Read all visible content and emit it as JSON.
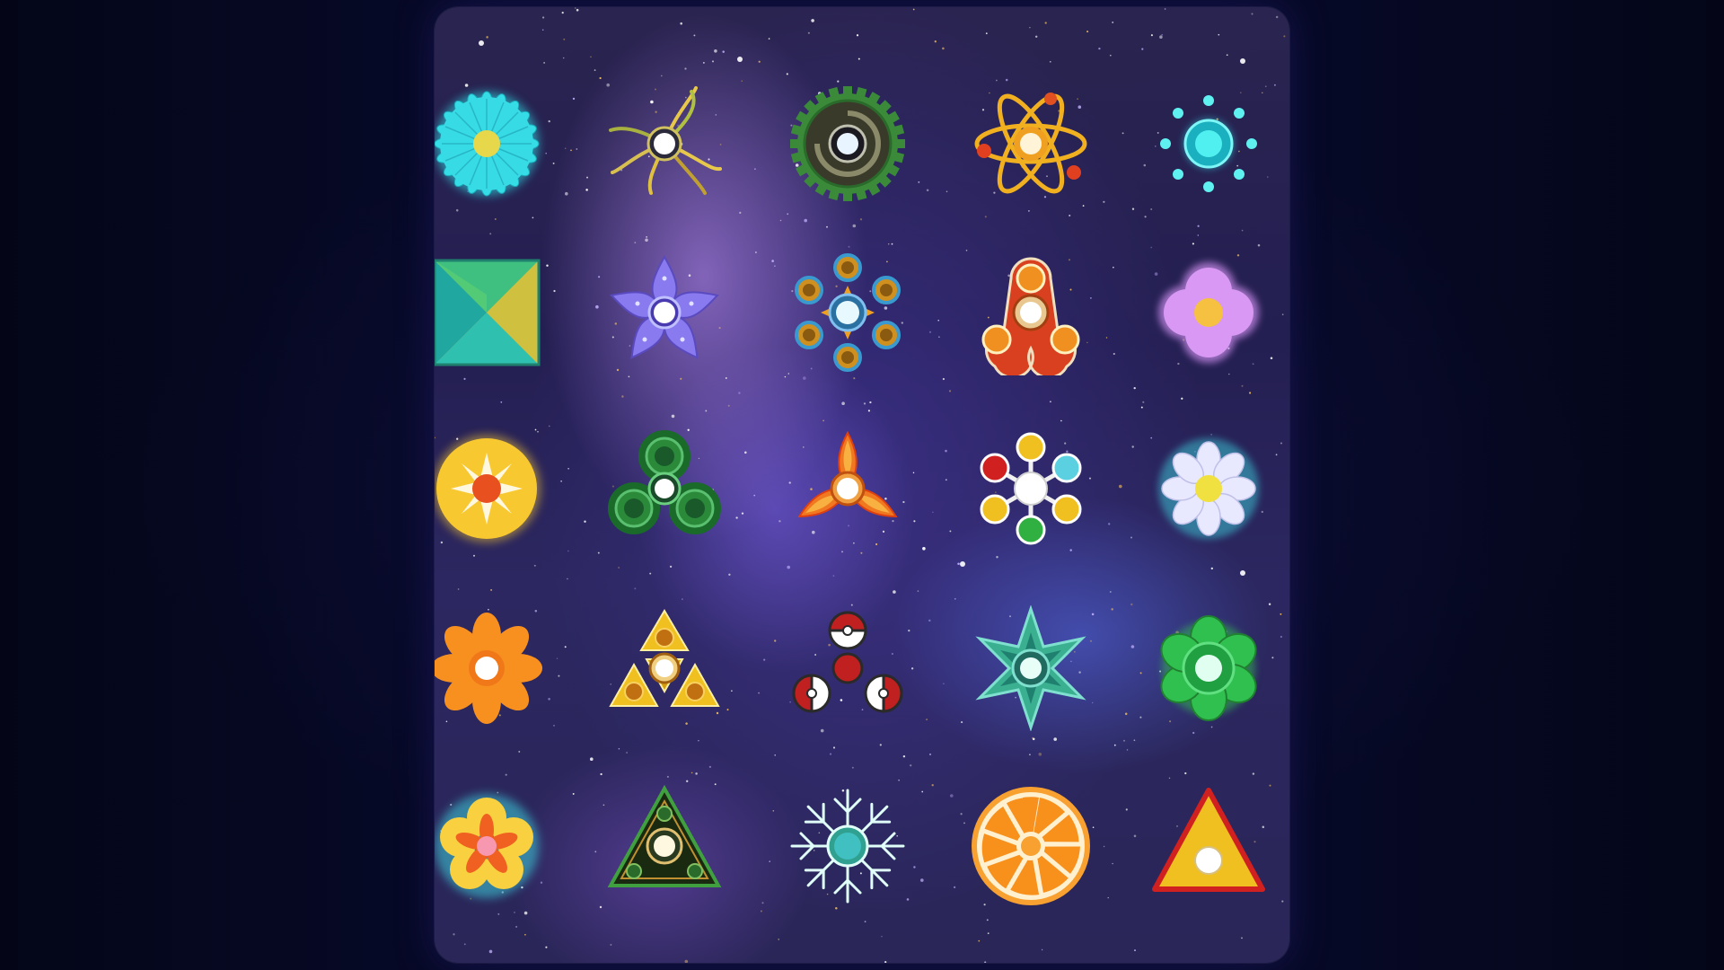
{
  "screen": "fidget-spinner-selection",
  "spinners": [
    {
      "id": "teal-daisy",
      "color": "#2fe0e8"
    },
    {
      "id": "golden-feather",
      "color": "#e8c84a"
    },
    {
      "id": "green-gear",
      "color": "#3aa050"
    },
    {
      "id": "atom",
      "color": "#f0b020"
    },
    {
      "id": "cyan-orbit",
      "color": "#40e0e8"
    },
    {
      "id": "prism-square",
      "color": "#30c090"
    },
    {
      "id": "purple-star-flower",
      "color": "#8a7af0"
    },
    {
      "id": "sunflower-ring",
      "color": "#f0a020"
    },
    {
      "id": "orange-tri-spinner",
      "color": "#e05020"
    },
    {
      "id": "lilac-clover",
      "color": "#d090f0"
    },
    {
      "id": "sun-disc",
      "color": "#f8c830"
    },
    {
      "id": "green-bubble",
      "color": "#2a8a3a"
    },
    {
      "id": "fire-blade",
      "color": "#f07820"
    },
    {
      "id": "six-ball",
      "color": "#f0c020"
    },
    {
      "id": "white-daisy",
      "color": "#e8e8ff"
    },
    {
      "id": "orange-flower",
      "color": "#f89020"
    },
    {
      "id": "gold-triforce",
      "color": "#f0c020"
    },
    {
      "id": "pokeball",
      "color": "#c02020"
    },
    {
      "id": "teal-star",
      "color": "#30a890"
    },
    {
      "id": "green-lotus",
      "color": "#30c050"
    },
    {
      "id": "hibiscus",
      "color": "#f8b020"
    },
    {
      "id": "dark-tri",
      "color": "#2a3a20"
    },
    {
      "id": "snowflake",
      "color": "#40c0a0"
    },
    {
      "id": "orange-slice",
      "color": "#f89020"
    },
    {
      "id": "triangle",
      "color": "#f0c020"
    }
  ]
}
